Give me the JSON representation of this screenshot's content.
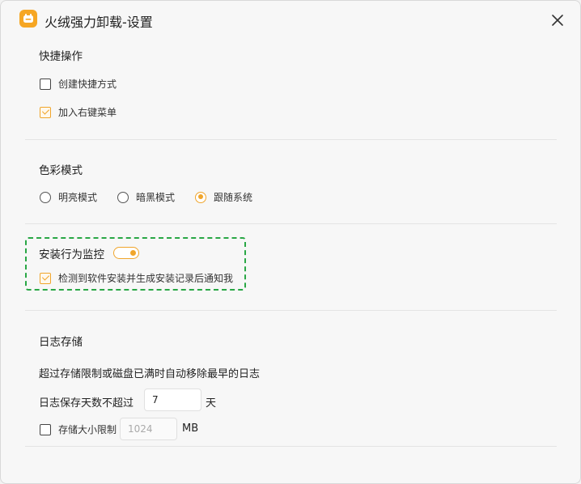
{
  "window": {
    "title": "火绒强力卸载-设置",
    "accent_color": "#f0a52b",
    "highlight_color": "#29a745"
  },
  "shortcut": {
    "title": "快捷操作",
    "options": [
      {
        "label": "创建快捷方式",
        "checked": false
      },
      {
        "label": "加入右键菜单",
        "checked": true
      }
    ]
  },
  "color_mode": {
    "title": "色彩模式",
    "options": [
      {
        "label": "明亮模式",
        "selected": false
      },
      {
        "label": "暗黑模式",
        "selected": false
      },
      {
        "label": "跟随系统",
        "selected": true
      }
    ]
  },
  "install_monitor": {
    "title": "安装行为监控",
    "enabled": true,
    "option": {
      "label": "检测到软件安装并生成安装记录后通知我",
      "checked": true
    }
  },
  "log_storage": {
    "title": "日志存储",
    "description": "超过存储限制或磁盘已满时自动移除最早的日志",
    "days_label": "日志保存天数不超过",
    "days_value": "7",
    "days_unit": "天",
    "size_limit": {
      "label": "存储大小限制",
      "checked": false,
      "value": "1024",
      "unit": "MB"
    }
  }
}
